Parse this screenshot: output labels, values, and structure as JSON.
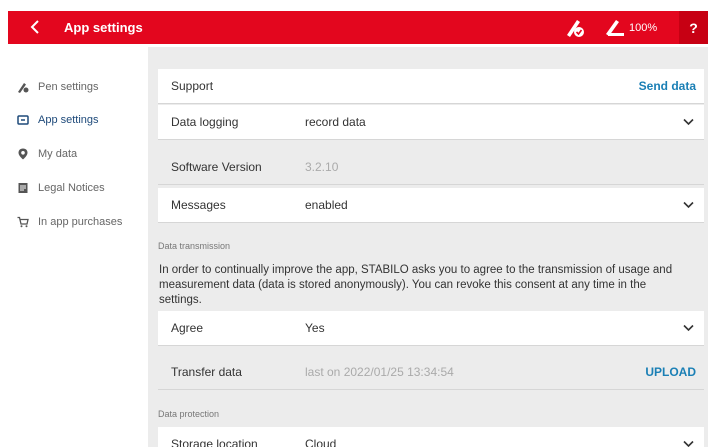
{
  "header": {
    "title": "App settings",
    "battery_text": "100%",
    "help_label": "?",
    "brand_color": "#e3061e"
  },
  "sidebar": {
    "items": [
      {
        "label": "Pen settings",
        "icon": "pen-icon"
      },
      {
        "label": "App settings",
        "icon": "app-settings-icon",
        "active": true
      },
      {
        "label": "My data",
        "icon": "location-pin-icon"
      },
      {
        "label": "Legal Notices",
        "icon": "document-icon"
      },
      {
        "label": "In app purchases",
        "icon": "cart-icon"
      }
    ]
  },
  "settings": {
    "support": {
      "label": "Support",
      "action": "Send data"
    },
    "data_logging": {
      "label": "Data logging",
      "value": "record data"
    },
    "software_version": {
      "label": "Software Version",
      "value": "3.2.10"
    },
    "messages": {
      "label": "Messages",
      "value": "enabled"
    }
  },
  "data_transmission": {
    "section": "Data transmission",
    "text": "In order to continually improve the app, STABILO asks you to agree to the transmission of usage and measurement data (data is stored anonymously). You can revoke this consent at any time in the settings.",
    "agree": {
      "label": "Agree",
      "value": "Yes"
    },
    "transfer": {
      "label": "Transfer data",
      "value": "last on 2022/01/25 13:34:54",
      "action": "UPLOAD"
    }
  },
  "data_protection": {
    "section": "Data protection",
    "storage": {
      "label": "Storage location",
      "value": "Cloud"
    }
  }
}
